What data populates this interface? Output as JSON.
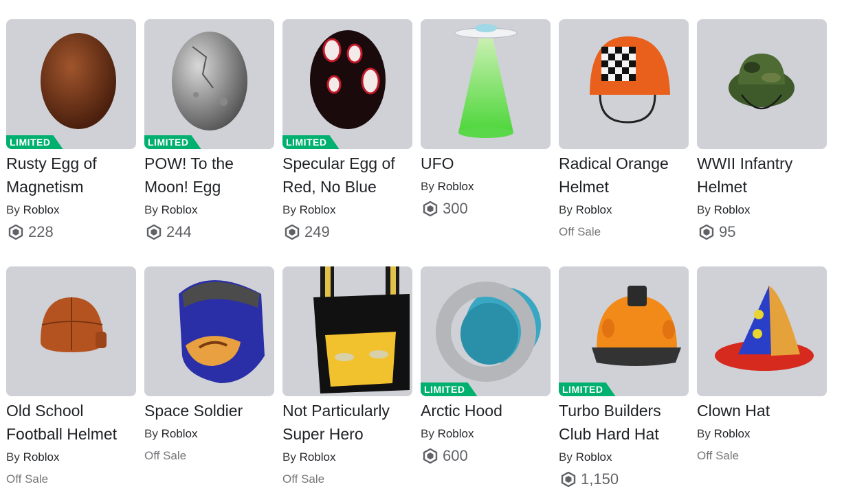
{
  "colors": {
    "limited_badge": "#00b06f",
    "thumb_bg": "#cfd1d7"
  },
  "items": [
    {
      "name": "Rusty Egg of Magnetism",
      "by": "By",
      "creator": "Roblox",
      "limited": "LIMITED",
      "price": "228",
      "offsale": "",
      "icon": "rusty-egg"
    },
    {
      "name": "POW! To the Moon! Egg",
      "by": "By",
      "creator": "Roblox",
      "limited": "LIMITED",
      "price": "244",
      "offsale": "",
      "icon": "moon-egg"
    },
    {
      "name": "Specular Egg of Red, No Blue",
      "by": "By",
      "creator": "Roblox",
      "limited": "LIMITED",
      "price": "249",
      "offsale": "",
      "icon": "spotted-egg"
    },
    {
      "name": "UFO",
      "by": "By",
      "creator": "Roblox",
      "limited": "",
      "price": "300",
      "offsale": "",
      "icon": "ufo"
    },
    {
      "name": "Radical Orange Helmet",
      "by": "By",
      "creator": "Roblox",
      "limited": "",
      "price": "",
      "offsale": "Off Sale",
      "icon": "orange-helmet"
    },
    {
      "name": "WWII Infantry Helmet",
      "by": "By",
      "creator": "Roblox",
      "limited": "",
      "price": "95",
      "offsale": "",
      "icon": "camo-helmet"
    },
    {
      "name": "Old School Football Helmet",
      "by": "By",
      "creator": "Roblox",
      "limited": "",
      "price": "",
      "offsale": "Off Sale",
      "icon": "leather-helmet"
    },
    {
      "name": "Space Soldier",
      "by": "By",
      "creator": "Roblox",
      "limited": "",
      "price": "",
      "offsale": "Off Sale",
      "icon": "space-helmet"
    },
    {
      "name": "Not Particularly Super Hero",
      "by": "By",
      "creator": "Roblox",
      "limited": "",
      "price": "",
      "offsale": "Off Sale",
      "icon": "hero-mask"
    },
    {
      "name": "Arctic Hood",
      "by": "By",
      "creator": "Roblox",
      "limited": "LIMITED",
      "price": "600",
      "offsale": "",
      "icon": "arctic-hood"
    },
    {
      "name": "Turbo Builders Club Hard Hat",
      "by": "By",
      "creator": "Roblox",
      "limited": "LIMITED",
      "price": "1,150",
      "offsale": "",
      "icon": "hard-hat"
    },
    {
      "name": "Clown Hat",
      "by": "By",
      "creator": "Roblox",
      "limited": "",
      "price": "",
      "offsale": "Off Sale",
      "icon": "clown-hat"
    }
  ]
}
